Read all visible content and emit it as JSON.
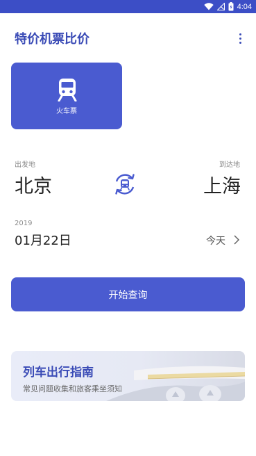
{
  "status_bar": {
    "time": "4:04",
    "icons": [
      "wifi-icon",
      "signal-off-icon",
      "battery-icon"
    ],
    "color": "#3c4ec6"
  },
  "header": {
    "title": "特价机票比价",
    "menu_icon": "more-vert-icon"
  },
  "mode_tile": {
    "label": "火车票",
    "icon": "train-icon",
    "color": "#4a5bd0"
  },
  "route": {
    "from_label": "出发地",
    "from_city": "北京",
    "to_label": "到达地",
    "to_city": "上海",
    "swap_icon": "swap-train-icon"
  },
  "date": {
    "year": "2019",
    "date": "01月22日",
    "relative": "今天",
    "chevron_icon": "chevron-right-icon"
  },
  "search_button": {
    "label": "开始查询"
  },
  "guide_card": {
    "title": "列车出行指南",
    "subtitle": "常见问题收集和旅客乘坐须知"
  },
  "colors": {
    "accent": "#4a5bd0",
    "title": "#3a4bb6"
  }
}
